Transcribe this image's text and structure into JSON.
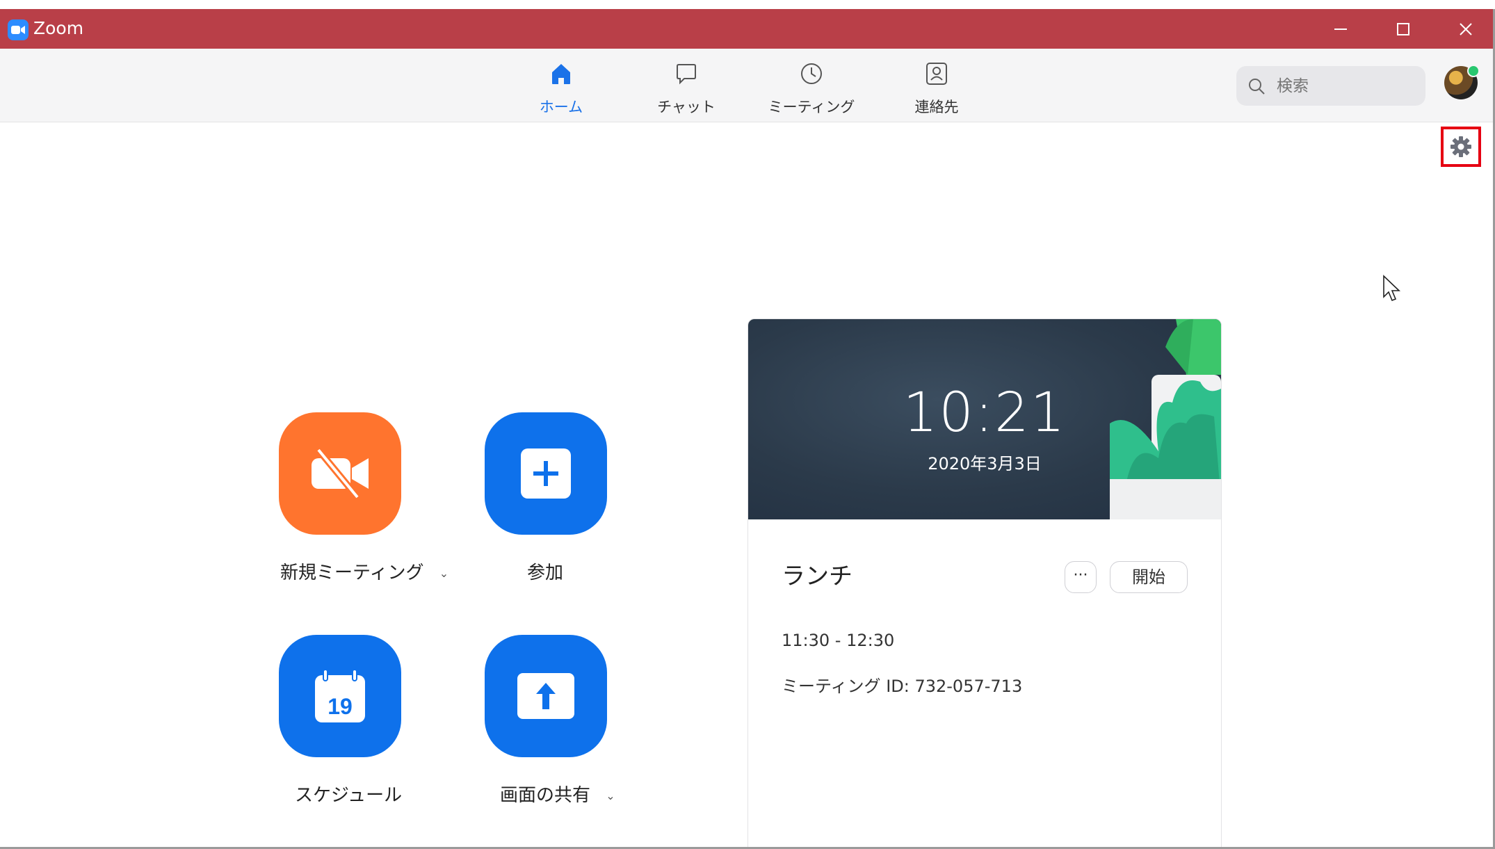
{
  "titlebar": {
    "app_name": "Zoom"
  },
  "nav": {
    "tabs": [
      {
        "label": "ホーム",
        "icon": "home-icon",
        "active": true
      },
      {
        "label": "チャット",
        "icon": "chat-icon",
        "active": false
      },
      {
        "label": "ミーティング",
        "icon": "clock-icon",
        "active": false
      },
      {
        "label": "連絡先",
        "icon": "contacts-icon",
        "active": false
      }
    ],
    "search_placeholder": "検索",
    "avatar_status": "online"
  },
  "actions": {
    "new_meeting": {
      "label": "新規ミーティング",
      "icon": "video-off-icon",
      "color": "#ff742e"
    },
    "join": {
      "label": "参加",
      "icon": "plus-icon",
      "color": "#0e71eb"
    },
    "schedule": {
      "label": "スケジュール",
      "icon": "calendar-icon",
      "calendar_day": "19",
      "color": "#0e71eb"
    },
    "share_screen": {
      "label": "画面の共有",
      "icon": "upload-arrow-icon",
      "color": "#0e71eb"
    }
  },
  "card": {
    "time": "10:21",
    "date": "2020年3月3日",
    "event": {
      "title": "ランチ",
      "more_label": "···",
      "start_label": "開始",
      "time_range": "11:30 - 12:30",
      "meeting_id": "ミーティング ID: 732-057-713"
    }
  },
  "colors": {
    "titlebar": "#b93f48",
    "accent": "#1b72e8",
    "highlight_box": "#e60012"
  }
}
